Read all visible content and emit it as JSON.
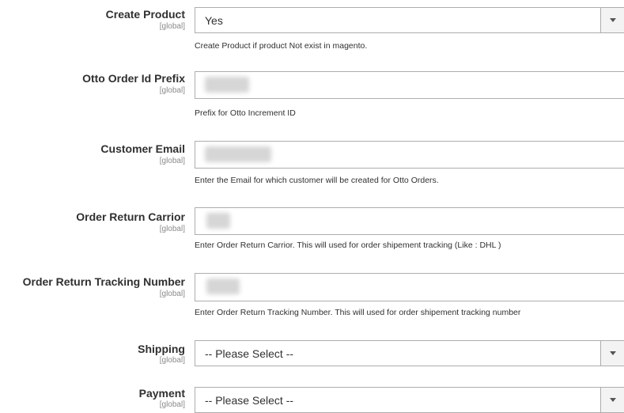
{
  "fields": [
    {
      "label": "Create Product",
      "scope": "[global]",
      "type": "select",
      "value": "Yes",
      "note": "Create Product if product Not exist in magento."
    },
    {
      "label": "Otto Order Id Prefix",
      "scope": "[global]",
      "type": "text",
      "value": "",
      "note": "Prefix for Otto Increment ID"
    },
    {
      "label": "Customer Email",
      "scope": "[global]",
      "type": "text",
      "value": "",
      "note": "Enter the Email for which customer will be created for Otto Orders."
    },
    {
      "label": "Order Return Carrior",
      "scope": "[global]",
      "type": "text",
      "value": "",
      "note": "Enter Order Return Carrior. This will used for order shipement tracking (Like : DHL )"
    },
    {
      "label": "Order Return Tracking Number",
      "scope": "[global]",
      "type": "text",
      "value": "",
      "note": "Enter Order Return Tracking Number. This will used for order shipement tracking number"
    },
    {
      "label": "Shipping",
      "scope": "[global]",
      "type": "select",
      "value": "-- Please Select --",
      "note": ""
    },
    {
      "label": "Payment",
      "scope": "[global]",
      "type": "select",
      "value": "-- Please Select --",
      "note": ""
    }
  ],
  "icons": {
    "dropdown": "chevron-down-icon"
  }
}
